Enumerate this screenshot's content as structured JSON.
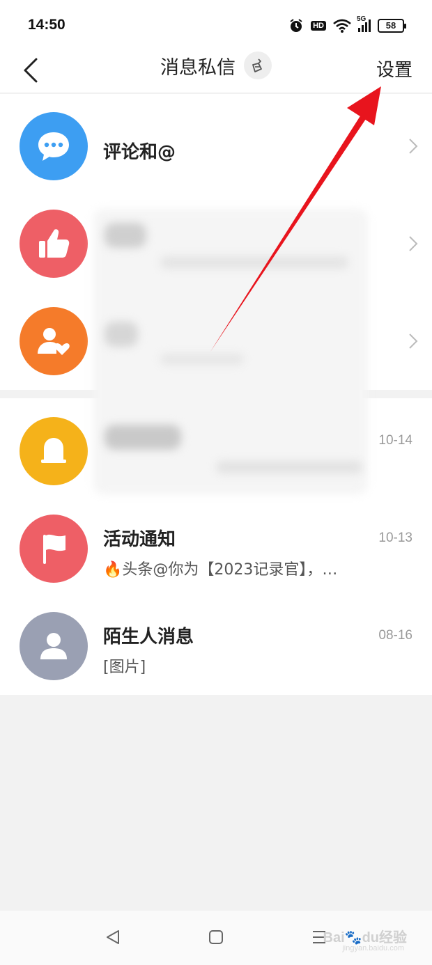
{
  "status_bar": {
    "time": "14:50",
    "battery": "58",
    "hd_label": "HD",
    "network_label": "5G"
  },
  "header": {
    "title": "消息私信",
    "settings_label": "设置"
  },
  "groups": [
    {
      "rows": [
        {
          "title": "评论和@",
          "color": "#3d9ef2",
          "icon": "chat-bubble-icon"
        },
        {
          "title": "",
          "color": "#ee5f66",
          "icon": "thumbs-up-icon"
        },
        {
          "title": "",
          "color": "#f57b2a",
          "icon": "user-heart-icon"
        }
      ]
    },
    {
      "rows": [
        {
          "title": "",
          "date": "10-14",
          "color": "#f5b21a",
          "icon": "bell-icon"
        },
        {
          "title": "活动通知",
          "subtitle": "🔥头条@你为【2023记录官】，…",
          "date": "10-13",
          "color": "#ee5f66",
          "icon": "flag-icon"
        },
        {
          "title": "陌生人消息",
          "subtitle": "[图片]",
          "date": "08-16",
          "color": "#9aa0b3",
          "icon": "person-icon"
        }
      ]
    }
  ],
  "watermark": {
    "brand": "Bai",
    "brand_suffix": "du",
    "tag": "经验",
    "url": "jingyan.baidu.com"
  }
}
